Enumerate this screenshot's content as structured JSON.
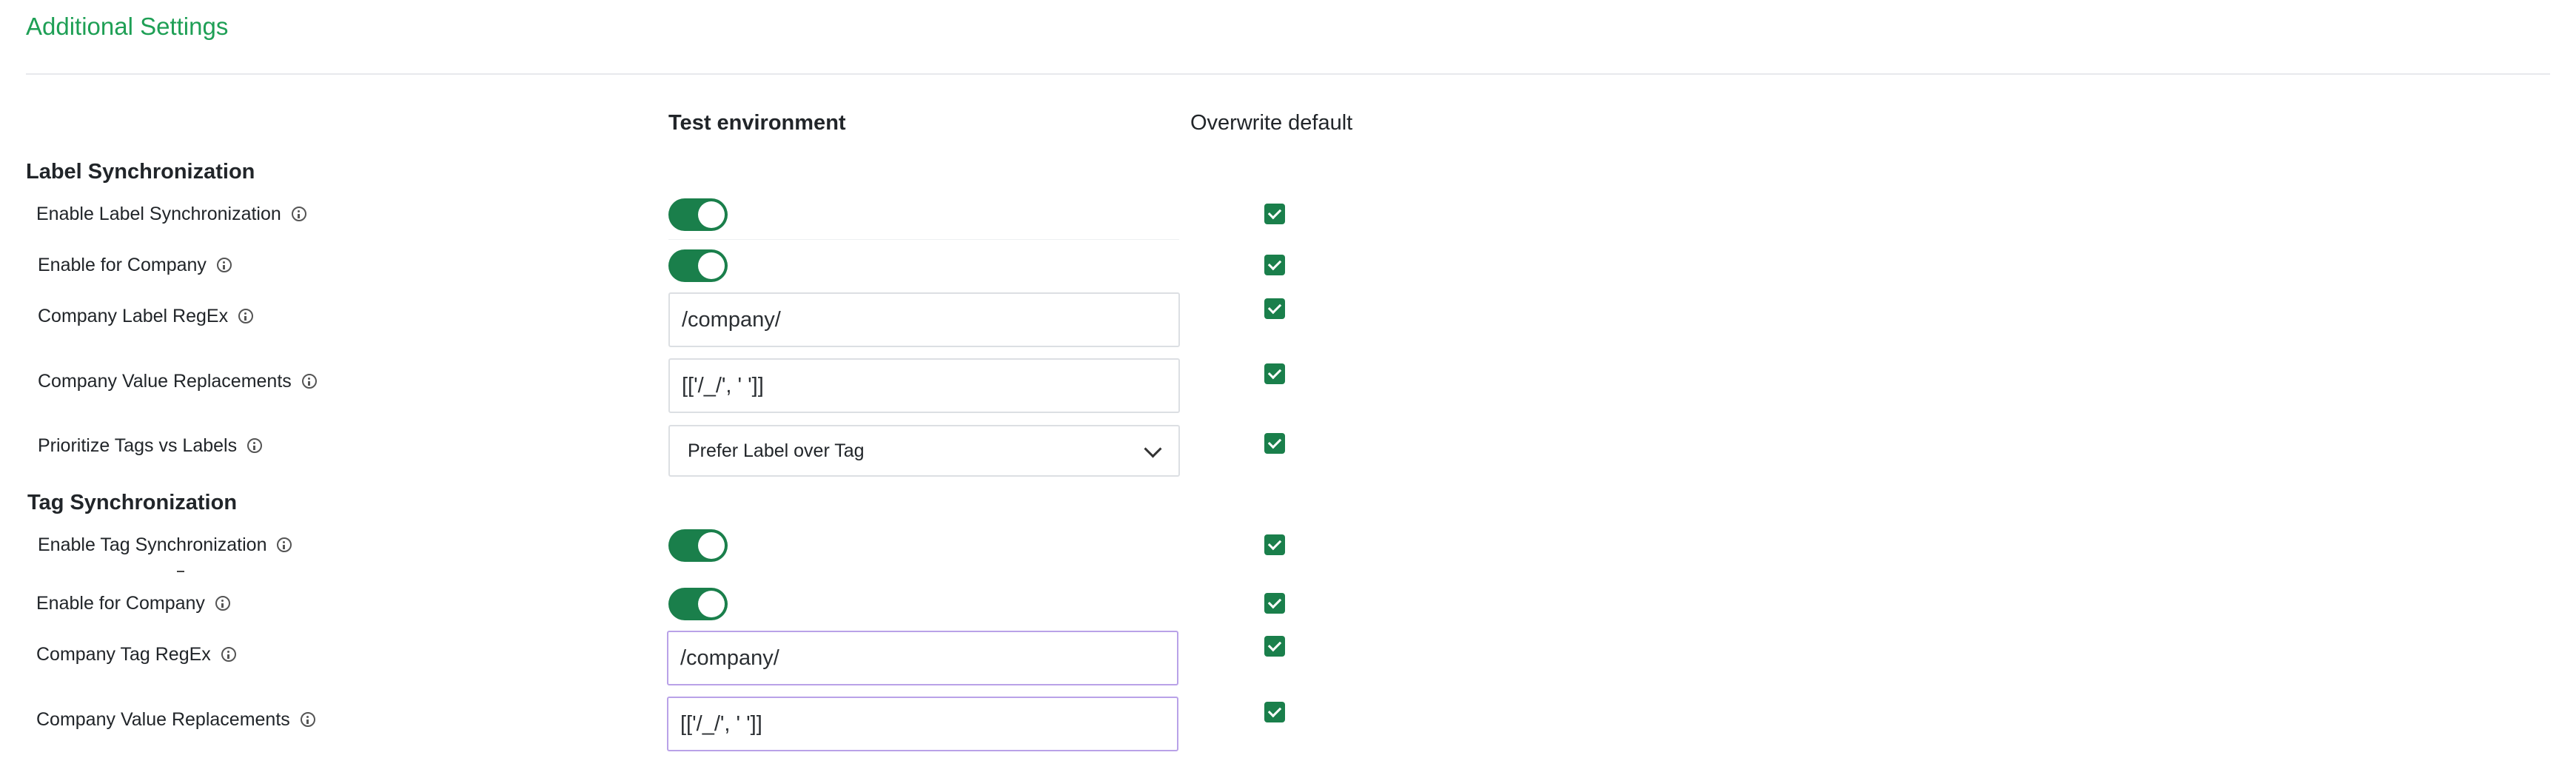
{
  "page": {
    "title": "Additional Settings"
  },
  "columns": {
    "test_environment": "Test environment",
    "overwrite_default": "Overwrite default"
  },
  "label_sync": {
    "heading": "Label Synchronization",
    "rows": [
      {
        "label": "Enable Label Synchronization",
        "control": "toggle",
        "on": true,
        "overwrite": true
      },
      {
        "label": "Enable for Company",
        "control": "toggle",
        "on": true,
        "overwrite": true
      },
      {
        "label": "Company Label RegEx",
        "control": "text",
        "value": "/company/",
        "overwrite": true
      },
      {
        "label": "Company Value Replacements",
        "control": "text",
        "value": "[['/_/', ' ']]",
        "overwrite": true
      },
      {
        "label": "Prioritize Tags vs Labels",
        "control": "select",
        "value": "Prefer Label over Tag",
        "overwrite": true
      }
    ]
  },
  "tag_sync": {
    "heading": "Tag Synchronization",
    "rows": [
      {
        "label": "Enable Tag Synchronization",
        "control": "toggle",
        "on": true,
        "overwrite": true
      },
      {
        "label": "Enable for Company",
        "control": "toggle",
        "on": true,
        "overwrite": true
      },
      {
        "label": "Company Tag RegEx",
        "control": "text",
        "value": "/company/",
        "overwrite": true
      },
      {
        "label": "Company Value Replacements",
        "control": "text",
        "value": "[['/_/', ' ']]",
        "overwrite": true
      }
    ]
  },
  "icons": {
    "info": "info-icon",
    "chevron": "chevron-down-icon",
    "check": "check-icon"
  },
  "colors": {
    "title": "#1e9f55",
    "toggle_on": "#1a7f4b",
    "checkbox_on": "#1a7f4b",
    "focus_border": "#b9a2e8"
  }
}
